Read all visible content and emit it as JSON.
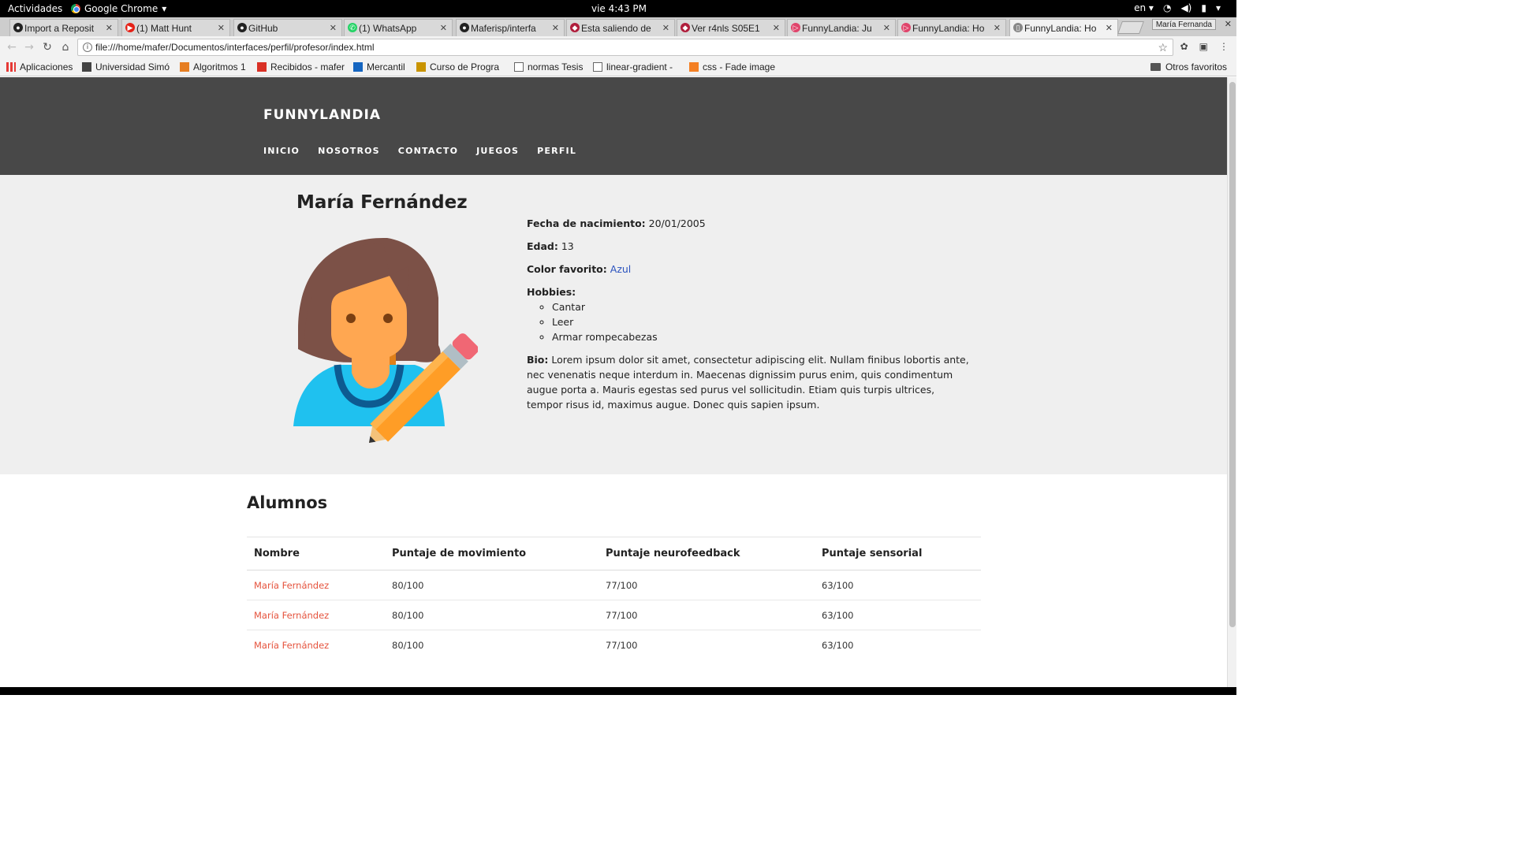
{
  "system_bar": {
    "activities": "Actividades",
    "app_name": "Google Chrome",
    "clock": "vie   4:43 PM",
    "language": "en"
  },
  "tabs": [
    {
      "label": "Import a Reposit",
      "icon": "github-icon"
    },
    {
      "label": "(1) Matt Hunt",
      "icon": "youtube-icon"
    },
    {
      "label": "GitHub",
      "icon": "github-icon"
    },
    {
      "label": "(1) WhatsApp",
      "icon": "whatsapp-icon"
    },
    {
      "label": "Maferisp/interfa",
      "icon": "github-icon"
    },
    {
      "label": "Esta saliendo de",
      "icon": "site-icon"
    },
    {
      "label": "Ver r4nls S05E1",
      "icon": "site-icon"
    },
    {
      "label": "FunnyLandia: Ju",
      "icon": "funnylandia-icon"
    },
    {
      "label": "FunnyLandia: Ho",
      "icon": "funnylandia-icon"
    },
    {
      "label": "FunnyLandia: Ho",
      "icon": "page-icon",
      "active": true
    }
  ],
  "profile_chip": "María Fernanda",
  "omnibox": {
    "url": "file:///home/mafer/Documentos/interfaces/perfil/profesor/index.html"
  },
  "bookmarks": [
    {
      "label": "Aplicaciones",
      "icon": "apps-grid-icon"
    },
    {
      "label": "Universidad Simó",
      "icon": "university-icon"
    },
    {
      "label": "Algoritmos 1",
      "icon": "site-icon"
    },
    {
      "label": "Recibidos - mafer",
      "icon": "gmail-icon"
    },
    {
      "label": "Mercantil",
      "icon": "bank-icon"
    },
    {
      "label": "Curso de Progra",
      "icon": "course-icon"
    },
    {
      "label": "normas Tesis",
      "icon": "page-icon"
    },
    {
      "label": "linear-gradient -",
      "icon": "page-icon"
    },
    {
      "label": "css - Fade image",
      "icon": "stackoverflow-icon"
    }
  ],
  "bookmarks_other": "Otros favoritos",
  "site": {
    "brand": "FUNNYLANDIA",
    "nav": [
      "INICIO",
      "NOSOTROS",
      "CONTACTO",
      "JUEGOS",
      "PERFIL"
    ]
  },
  "profile": {
    "name": "María Fernández",
    "birth_label": "Fecha de nacimiento:",
    "birth_value": "20/01/2005",
    "age_label": "Edad:",
    "age_value": "13",
    "color_label": "Color favorito:",
    "color_value": "Azul",
    "hobbies_label": "Hobbies:",
    "hobbies": [
      "Cantar",
      "Leer",
      "Armar rompecabezas"
    ],
    "bio_label": "Bio:",
    "bio_text": "Lorem ipsum dolor sit amet, consectetur adipiscing elit. Nullam finibus lobortis ante, nec venenatis neque interdum in. Maecenas dignissim purus enim, quis condimentum augue porta a. Mauris egestas sed purus vel sollicitudin. Etiam quis turpis ultrices, tempor risus id, maximus augue. Donec quis sapien ipsum."
  },
  "students": {
    "title": "Alumnos",
    "columns": [
      "Nombre",
      "Puntaje de movimiento",
      "Puntaje neurofeedback",
      "Puntaje sensorial"
    ],
    "rows": [
      [
        "María Fernández",
        "80/100",
        "77/100",
        "63/100"
      ],
      [
        "María Fernández",
        "80/100",
        "77/100",
        "63/100"
      ],
      [
        "María Fernández",
        "80/100",
        "77/100",
        "63/100"
      ]
    ]
  },
  "colors": {
    "header_bg": "#484848",
    "profile_bg": "#efefef",
    "student_link": "#e5533d",
    "color_link": "#2a52be"
  }
}
